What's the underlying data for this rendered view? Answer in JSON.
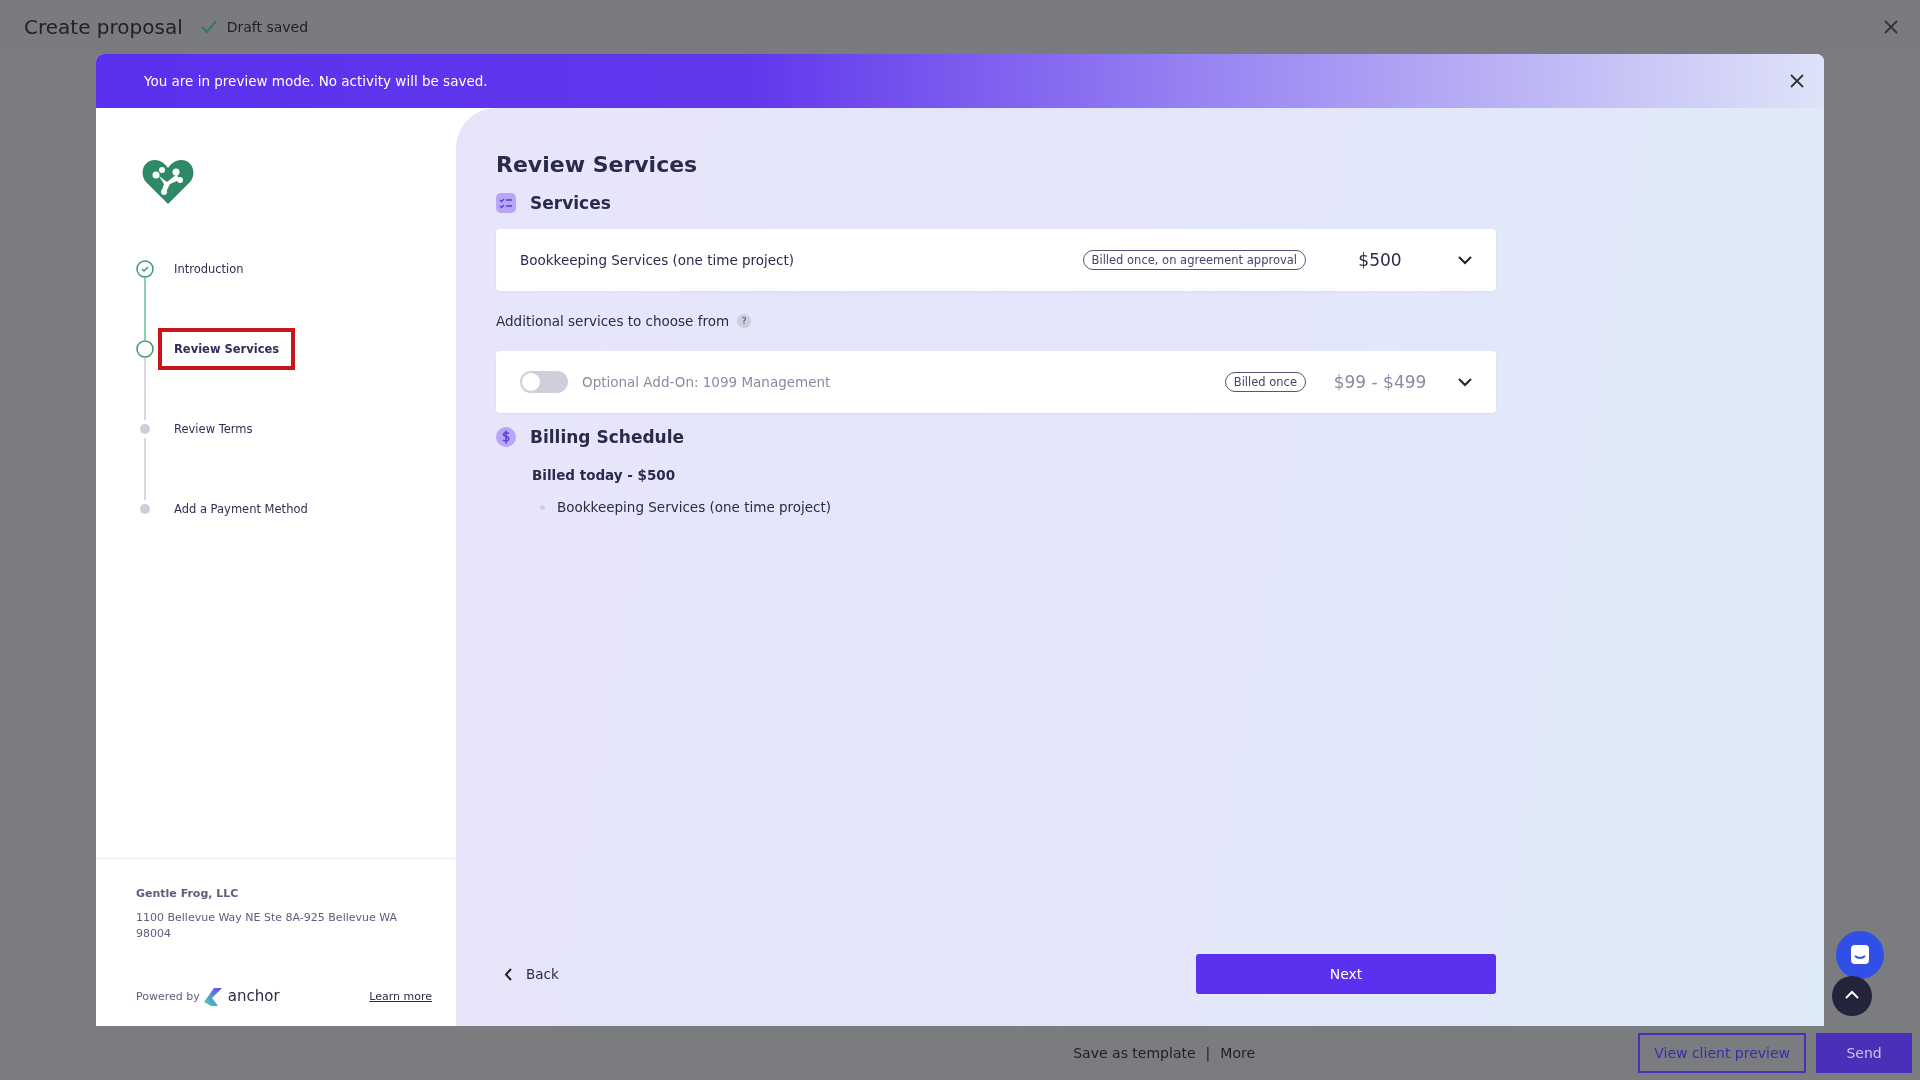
{
  "top_bar": {
    "title": "Create proposal",
    "status": "Draft saved"
  },
  "preview_banner": {
    "text": "You are in preview mode. No activity will be saved."
  },
  "steps": [
    {
      "label": "Introduction",
      "kind": "done",
      "highlighted": false
    },
    {
      "label": "Review Services",
      "kind": "current",
      "highlighted": true
    },
    {
      "label": "Review Terms",
      "kind": "upcoming",
      "highlighted": false
    },
    {
      "label": "Add a Payment Method",
      "kind": "upcoming",
      "highlighted": false
    }
  ],
  "company": {
    "name": "Gentle Frog, LLC",
    "address": "1100 Bellevue Way NE Ste 8A-925 Bellevue WA 98004"
  },
  "powered_by": {
    "label": "Powered by",
    "brand": "anchor",
    "link": "Learn more"
  },
  "page_title": "Review Services",
  "services": {
    "heading": "Services",
    "items": [
      {
        "name": "Bookkeeping Services (one time project)",
        "billing": "Billed once, on agreement approval",
        "price": "$500"
      }
    ]
  },
  "additional": {
    "label": "Additional services to choose from",
    "help": "?",
    "items": [
      {
        "name": "Optional Add-On: 1099 Management",
        "on": false,
        "billing": "Billed once",
        "price": "$99 - $499"
      }
    ]
  },
  "billing_schedule": {
    "heading": "Billing Schedule",
    "groups": [
      {
        "title": "Billed today - $500",
        "items": [
          "Bookkeeping Services (one time project)"
        ]
      }
    ]
  },
  "nav": {
    "back": "Back",
    "next": "Next"
  },
  "bottom_bar": {
    "links": [
      "Save as template",
      "More"
    ],
    "separator": "|",
    "preview": "View client preview",
    "send": "Send"
  }
}
